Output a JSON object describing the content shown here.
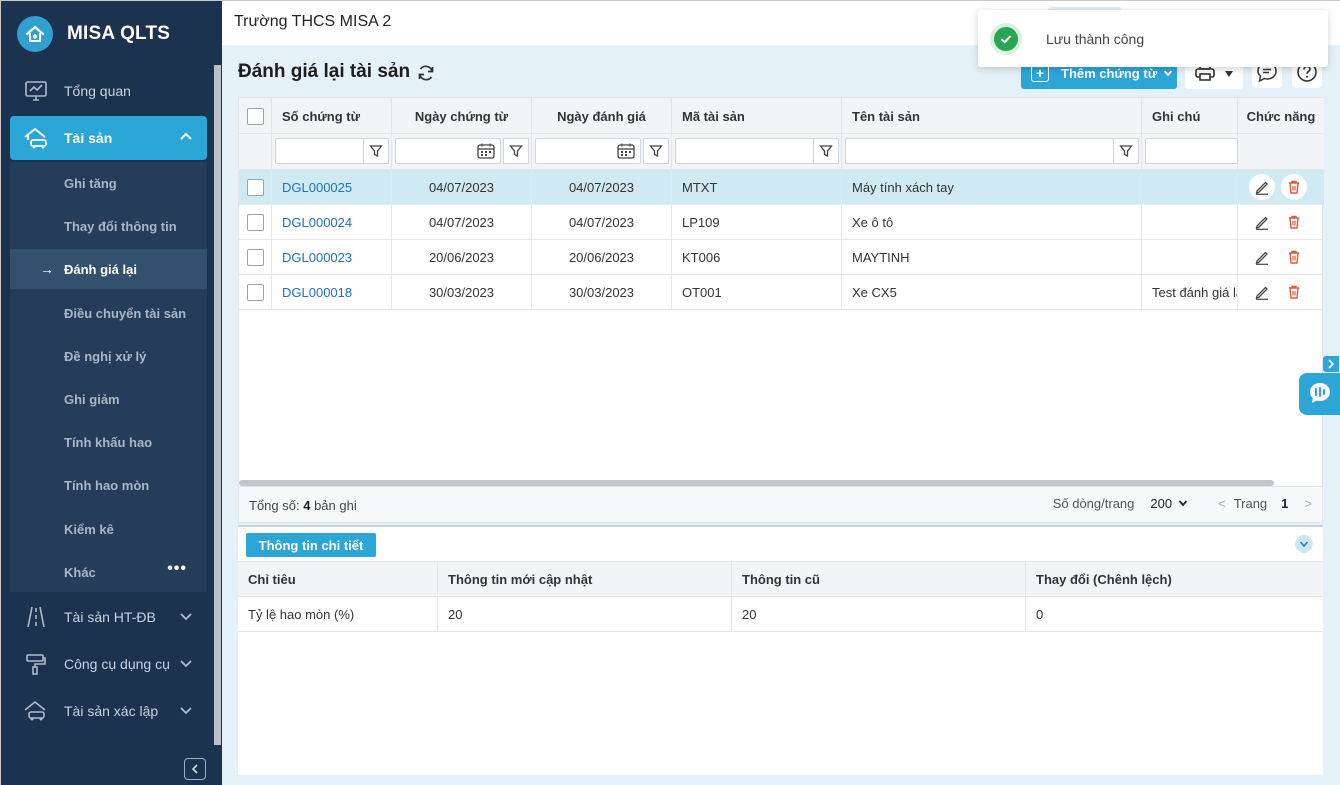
{
  "app": {
    "name": "MISA QLTS"
  },
  "sidebar": {
    "overview": "Tổng quan",
    "asset": "Tài sản",
    "submenu": [
      "Ghi tăng",
      "Thay đổi thông tin",
      "Đánh giá lại",
      "Điều chuyển tài sản",
      "Đề nghị xử lý",
      "Ghi giảm",
      "Tính khấu hao",
      "Tính hao mòn",
      "Kiểm kê",
      "Khác"
    ],
    "more_dots": "•••",
    "active_arrow": "→",
    "groups": [
      "Tài sản HT-ĐB",
      "Công cụ dụng cụ",
      "Tài sản xác lập"
    ]
  },
  "header": {
    "org_name": "Trường THCS MISA 2"
  },
  "page": {
    "title": "Đánh giá lại tài sản",
    "add_button": "Thêm chứng từ"
  },
  "grid": {
    "columns": [
      "Số chứng từ",
      "Ngày chứng từ",
      "Ngày đánh giá",
      "Mã tài sản",
      "Tên tài sản",
      "Ghi chú",
      "Chức năng"
    ],
    "rows": [
      {
        "code": "DGL000025",
        "doc_date": "04/07/2023",
        "eval_date": "04/07/2023",
        "asset_code": "MTXT",
        "asset_name": "Máy tính xách tay",
        "note": ""
      },
      {
        "code": "DGL000024",
        "doc_date": "04/07/2023",
        "eval_date": "04/07/2023",
        "asset_code": "LP109",
        "asset_name": "Xe ô tô",
        "note": ""
      },
      {
        "code": "DGL000023",
        "doc_date": "20/06/2023",
        "eval_date": "20/06/2023",
        "asset_code": "KT006",
        "asset_name": "MAYTINH",
        "note": ""
      },
      {
        "code": "DGL000018",
        "doc_date": "30/03/2023",
        "eval_date": "30/03/2023",
        "asset_code": "OT001",
        "asset_name": "Xe CX5",
        "note": "Test đánh giá lại"
      }
    ],
    "footer": {
      "total_prefix": "Tổng số:",
      "total_count": "4",
      "total_suffix": "bản ghi",
      "rows_per_page_label": "Số dòng/trang",
      "rows_per_page": "200",
      "prev": "<",
      "page_label": "Trang",
      "page": "1",
      "next": ">"
    }
  },
  "detail": {
    "tab": "Thông tin chi tiết",
    "columns": [
      "Chỉ tiêu",
      "Thông tin mới cập nhật",
      "Thông tin cũ",
      "Thay đổi (Chênh lệch)"
    ],
    "rows": [
      {
        "criterion": "Tỷ lệ hao mòn (%)",
        "new": "20",
        "old": "20",
        "diff": "0"
      }
    ]
  },
  "toast": {
    "message": "Lưu thành công"
  },
  "colors": {
    "accent": "#2ba6d6",
    "sidebar": "#1c3350",
    "link": "#1f6fcf",
    "delete": "#e05a3a",
    "success": "#2aa554"
  }
}
